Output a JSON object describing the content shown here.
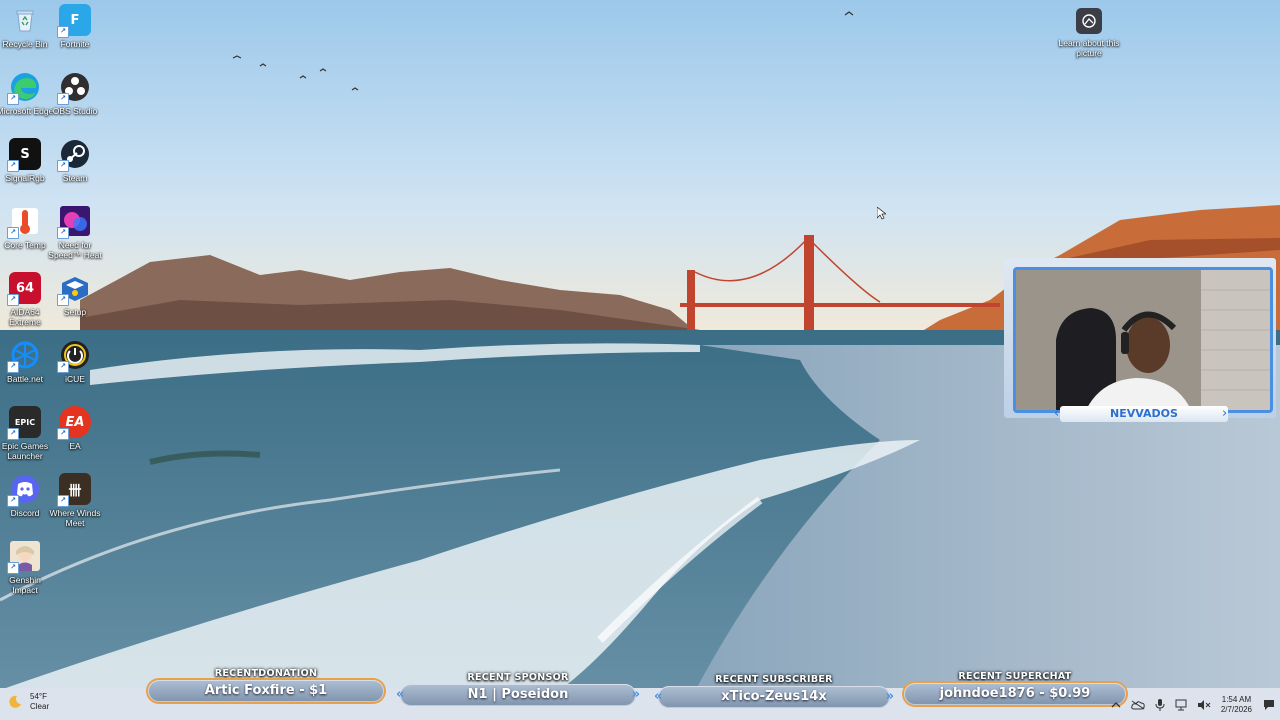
{
  "desktop": {
    "icons": [
      {
        "label": "Recycle Bin",
        "icon": "recycle-bin-icon",
        "color": "#d9e6f5"
      },
      {
        "label": "Fortnite",
        "icon": "fortnite-icon",
        "color": "#2aa7e8"
      },
      {
        "label": "Microsoft Edge",
        "icon": "edge-icon",
        "color": "#1fa463"
      },
      {
        "label": "OBS Studio",
        "icon": "obs-icon",
        "color": "#302e31"
      },
      {
        "label": "SignalRgb",
        "icon": "signalrgb-icon",
        "color": "#111111"
      },
      {
        "label": "Steam",
        "icon": "steam-icon",
        "color": "#1b2838"
      },
      {
        "label": "Core Temp",
        "icon": "core-temp-icon",
        "color": "#e84c2b"
      },
      {
        "label": "Need for Speed™ Heat",
        "icon": "nfs-heat-icon",
        "color": "#6a2aa8"
      },
      {
        "label": "AIDA64 Extreme",
        "icon": "aida64-icon",
        "color": "#c8102e"
      },
      {
        "label": "Setup",
        "icon": "setup-icon",
        "color": "#2b6cc4"
      },
      {
        "label": "Battle.net",
        "icon": "battlenet-icon",
        "color": "#148eff"
      },
      {
        "label": "iCUE",
        "icon": "icue-icon",
        "color": "#222222"
      },
      {
        "label": "Epic Games Launcher",
        "icon": "epic-games-icon",
        "color": "#2a2a2a"
      },
      {
        "label": "EA",
        "icon": "ea-icon",
        "color": "#e4341f"
      },
      {
        "label": "Discord",
        "icon": "discord-icon",
        "color": "#5865f2"
      },
      {
        "label": "Where Winds Meet",
        "icon": "where-winds-meet-icon",
        "color": "#3a2f22"
      },
      {
        "label": "Genshin Impact",
        "icon": "genshin-icon",
        "color": "#efe4d2"
      }
    ],
    "learn_label": "Learn about this picture"
  },
  "webcam": {
    "name": "NEVVADOS"
  },
  "alerts": [
    {
      "title": "RECENTDONATION",
      "value": "Artic Foxfire - $1"
    },
    {
      "title": "RECENT SPONSOR",
      "value": "N1 | Poseidon"
    },
    {
      "title": "RECENT SUBSCRIBER",
      "value": "xTico-Zeus14x"
    },
    {
      "title": "RECENT SUPERCHAT",
      "value": "johndoe1876 - $0.99"
    }
  ],
  "taskbar": {
    "weather_temp": "54°F",
    "weather_cond": "Clear",
    "time": "1:54 AM",
    "date": "2/7/2026"
  },
  "icon_glyphs": {
    "fortnite": "F",
    "signalrgb": "S",
    "aida64": "64",
    "epic": "EPIC",
    "ea": "EA",
    "where_winds": "卌"
  }
}
